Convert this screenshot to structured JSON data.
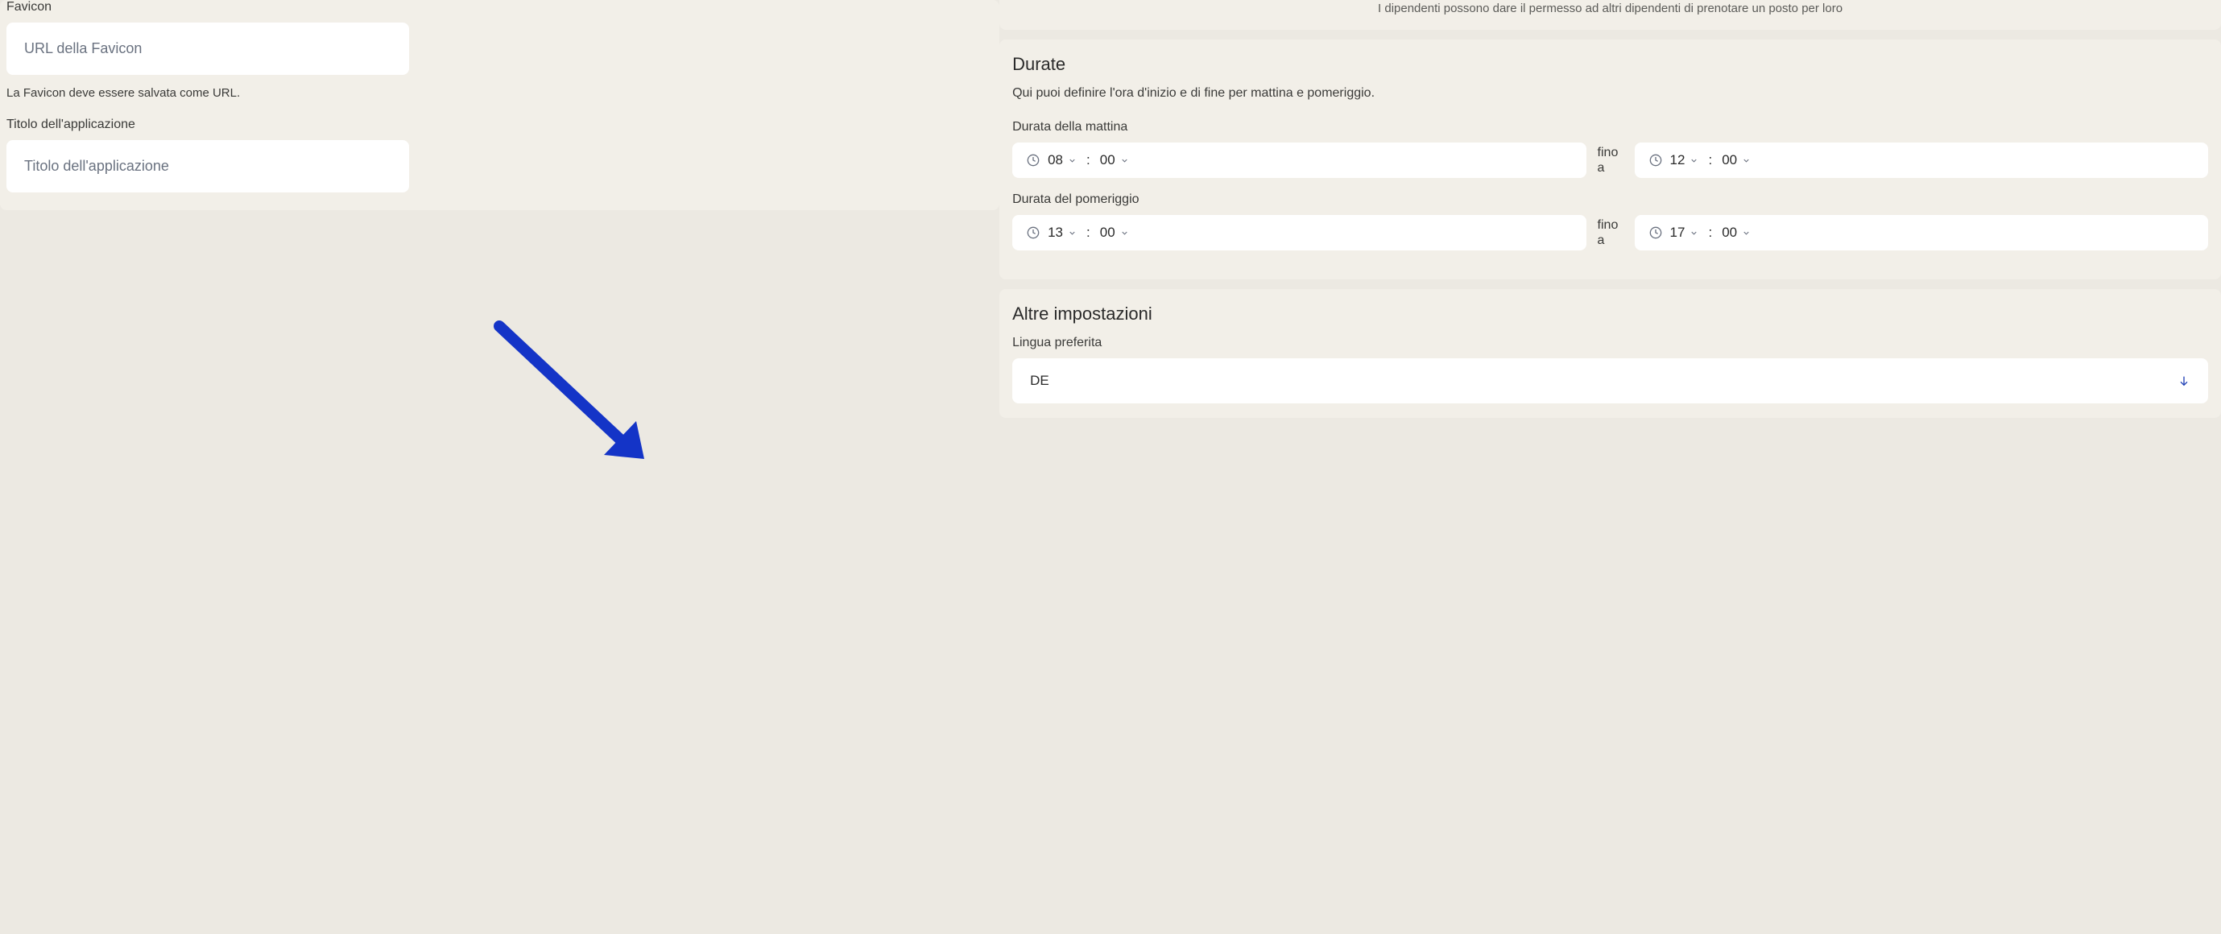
{
  "left": {
    "favicon_label": "Favicon",
    "favicon_placeholder": "URL della Favicon",
    "favicon_help": "La Favicon deve essere salvata come URL.",
    "app_title_label": "Titolo dell'applicazione",
    "app_title_placeholder": "Titolo dell'applicazione"
  },
  "top_panel": {
    "text": "I dipendenti possono dare il permesso ad altri dipendenti di prenotare un posto per loro"
  },
  "durations": {
    "title": "Durate",
    "description": "Qui puoi definire l'ora d'inizio e di fine per mattina e pomeriggio.",
    "morning_label": "Durata della mattina",
    "afternoon_label": "Durata del pomeriggio",
    "separator": "fino a",
    "morning_start_hour": "08",
    "morning_start_min": "00",
    "morning_end_hour": "12",
    "morning_end_min": "00",
    "afternoon_start_hour": "13",
    "afternoon_start_min": "00",
    "afternoon_end_hour": "17",
    "afternoon_end_min": "00"
  },
  "other_settings": {
    "title": "Altre impostazioni",
    "language_label": "Lingua preferita",
    "language_value": "DE"
  }
}
